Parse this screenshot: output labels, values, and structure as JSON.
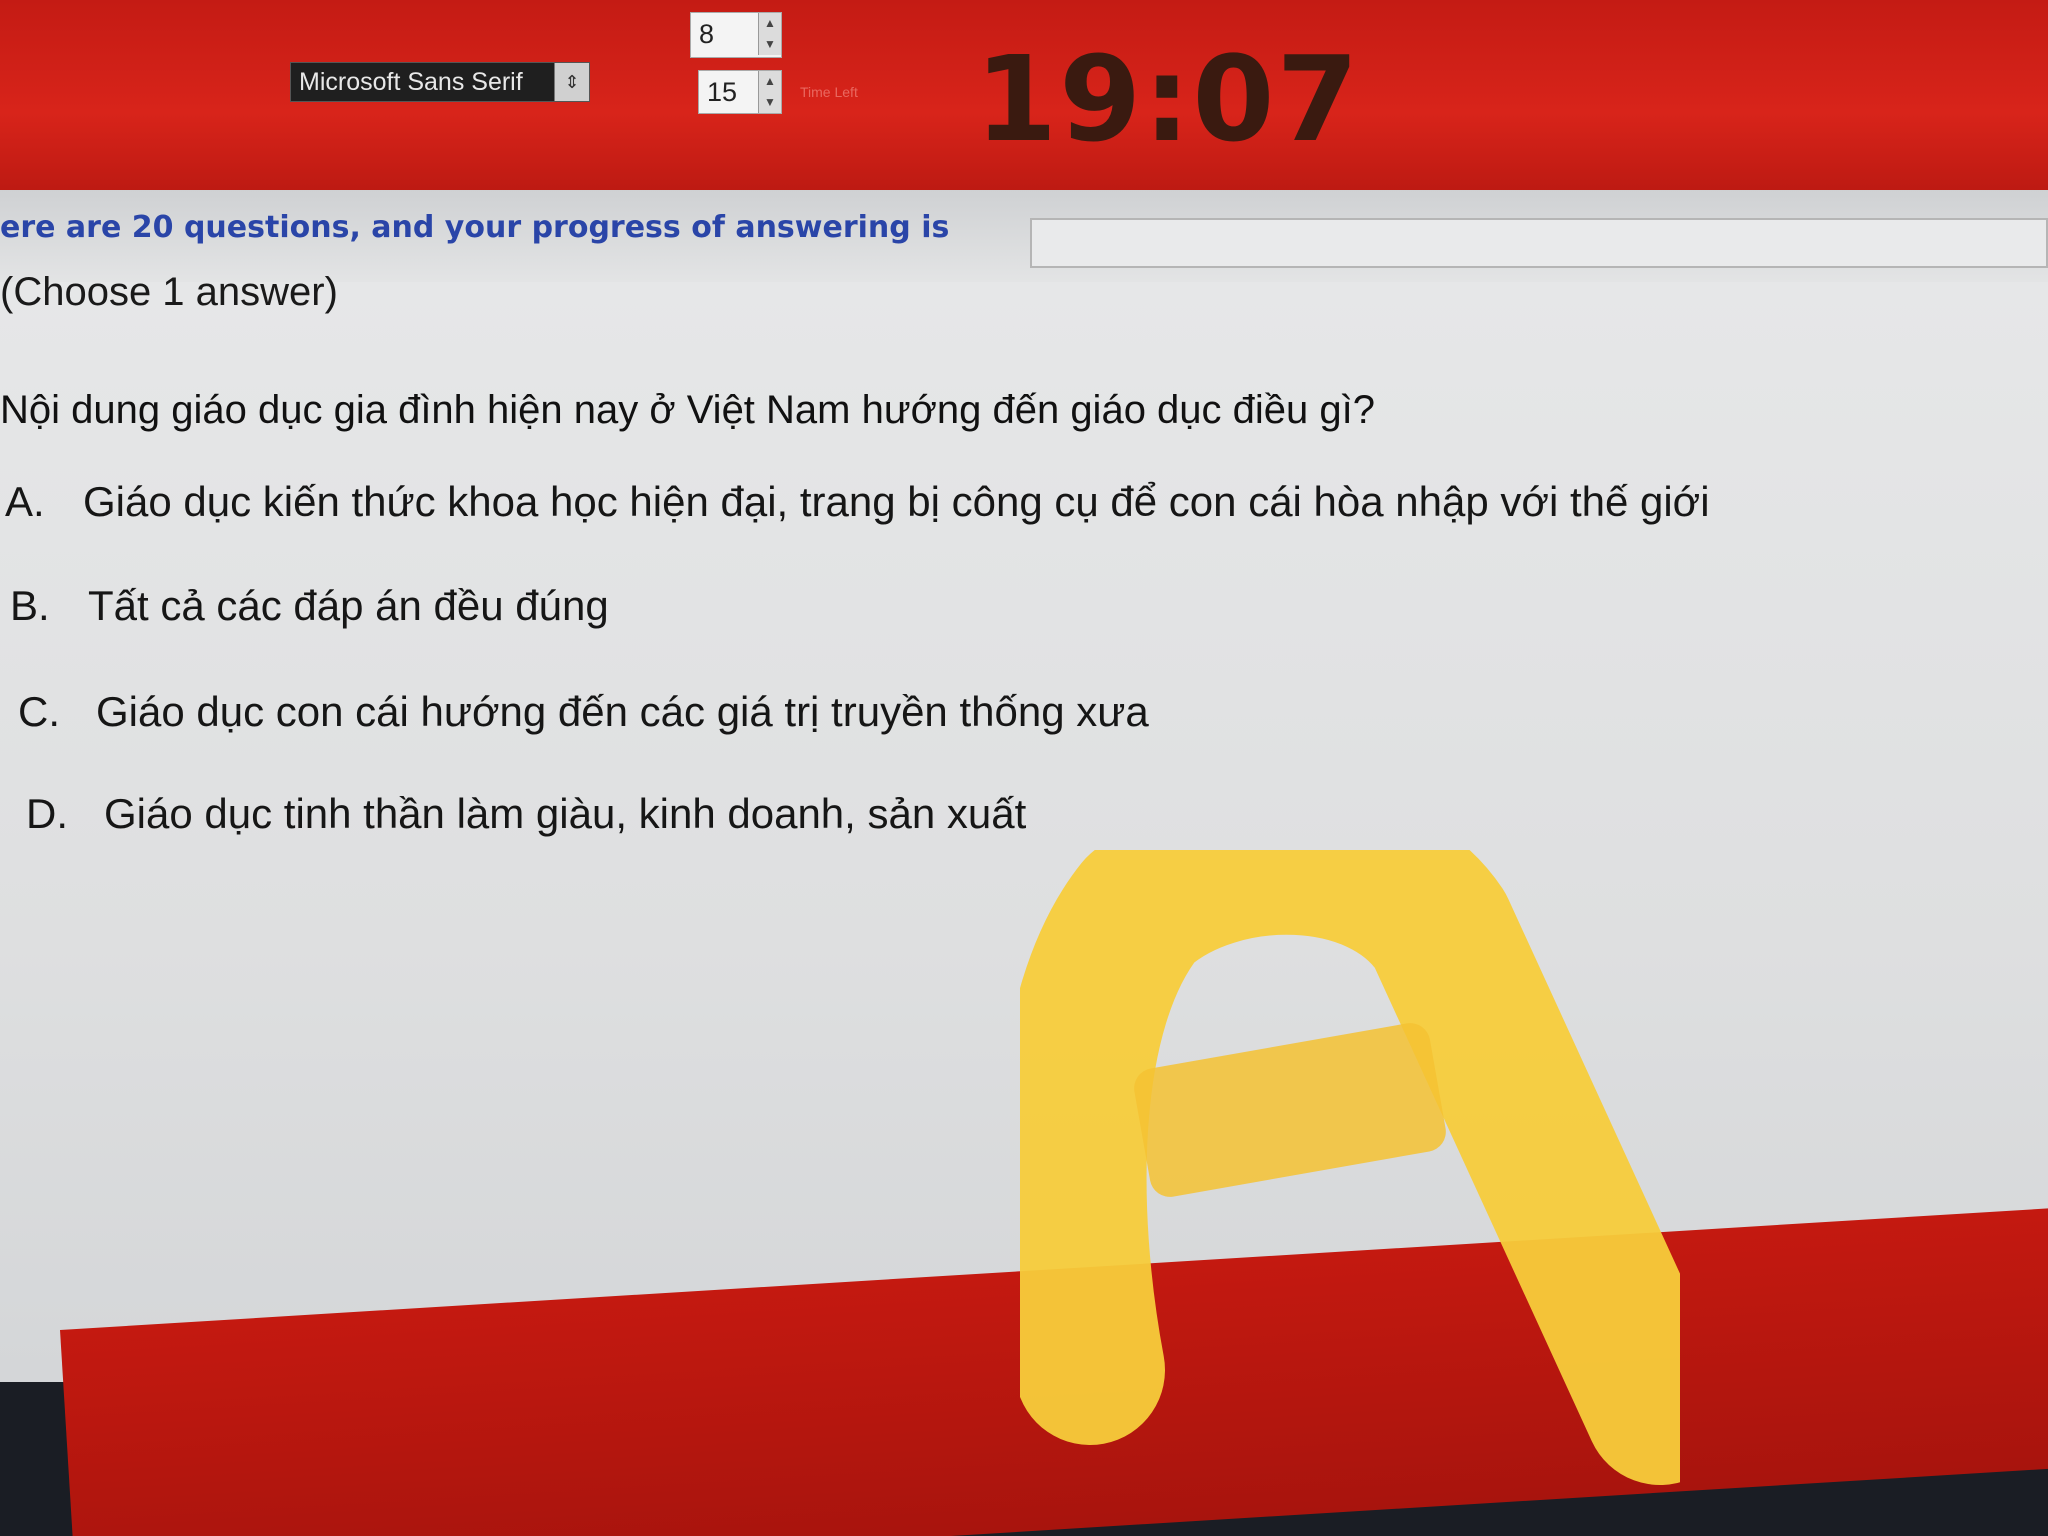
{
  "toolbar": {
    "font_name": "Microsoft Sans Serif",
    "font_size_top": "8",
    "font_size": "15",
    "time_left_label": "Time Left",
    "timer": "19:07"
  },
  "progress": {
    "text": "ere are 20 questions, and your progress of answering is"
  },
  "question": {
    "instruction": "(Choose 1 answer)",
    "text": "Nội dung giáo dục gia đình hiện nay ở Việt Nam hướng đến giáo dục điều gì?",
    "options": [
      {
        "letter": "A.",
        "text": "Giáo dục kiến thức khoa học hiện đại, trang bị công cụ để con cái hòa nhập với thế giới"
      },
      {
        "letter": "B.",
        "text": "Tất cả các đáp án đều đúng"
      },
      {
        "letter": "C.",
        "text": "Giáo dục con cái hướng đến các giá trị truyền thống xưa"
      },
      {
        "letter": "D.",
        "text": "Giáo dục tinh thần làm giàu, kinh doanh, sản xuất"
      }
    ]
  },
  "annotation": {
    "letter": "A",
    "color": "#f7cc3b"
  }
}
